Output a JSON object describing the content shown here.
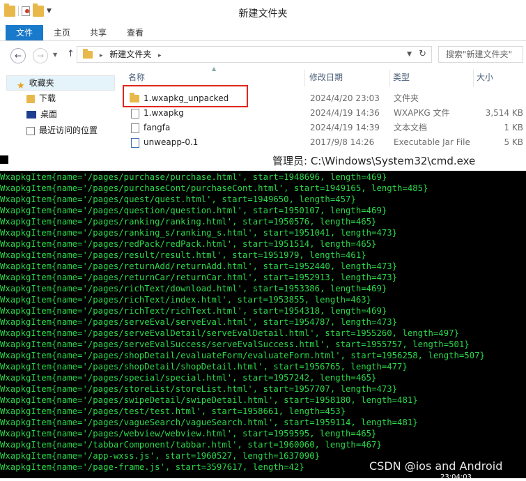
{
  "explorer": {
    "title": "新建文件夹",
    "ribbon_tabs": [
      "文件",
      "主页",
      "共享",
      "查看"
    ],
    "address": {
      "sep": "▸",
      "folder": "新建文件夹"
    },
    "search_placeholder": "搜索\"新建文件夹\"",
    "nav_items": [
      "收藏夹",
      "下载",
      "桌面",
      "最近访问的位置"
    ],
    "columns": [
      "名称",
      "修改日期",
      "类型",
      "大小"
    ],
    "files": [
      {
        "name": "1.wxapkg_unpacked",
        "date": "2024/4/20 23:03",
        "type": "文件夹",
        "size": ""
      },
      {
        "name": "1.wxapkg",
        "date": "2024/4/19 14:36",
        "type": "WXAPKG 文件",
        "size": "3,514 KB"
      },
      {
        "name": "fangfa",
        "date": "2024/4/19 14:39",
        "type": "文本文档",
        "size": "1 KB"
      },
      {
        "name": "unweapp-0.1",
        "date": "2017/9/8 14:26",
        "type": "Executable Jar File",
        "size": "5 KB"
      }
    ]
  },
  "cmd": {
    "title": "管理员: C:\\Windows\\System32\\cmd.exe",
    "lines": [
      "WxapkgItem{name='/pages/purchase/purchase.html', start=1948696, length=469}",
      "WxapkgItem{name='/pages/purchaseCont/purchaseCont.html', start=1949165, length=485}",
      "WxapkgItem{name='/pages/quest/quest.html', start=1949650, length=457}",
      "WxapkgItem{name='/pages/question/question.html', start=1950107, length=469}",
      "WxapkgItem{name='/pages/ranking/ranking.html', start=1950576, length=465}",
      "WxapkgItem{name='/pages/ranking_s/ranking_s.html', start=1951041, length=473}",
      "WxapkgItem{name='/pages/redPack/redPack.html', start=1951514, length=465}",
      "WxapkgItem{name='/pages/result/result.html', start=1951979, length=461}",
      "WxapkgItem{name='/pages/returnAdd/returnAdd.html', start=1952440, length=473}",
      "WxapkgItem{name='/pages/returnCar/returnCar.html', start=1952913, length=473}",
      "WxapkgItem{name='/pages/richText/download.html', start=1953386, length=469}",
      "WxapkgItem{name='/pages/richText/index.html', start=1953855, length=463}",
      "WxapkgItem{name='/pages/richText/richText.html', start=1954318, length=469}",
      "WxapkgItem{name='/pages/serveEval/serveEval.html', start=1954787, length=473}",
      "WxapkgItem{name='/pages/serveEvalDetail/serveEvalDetail.html', start=1955260, length=497}",
      "WxapkgItem{name='/pages/serveEvalSuccess/serveEvalSuccess.html', start=1955757, length=501}",
      "WxapkgItem{name='/pages/shopDetail/evaluateForm/evaluateForm.html', start=1956258, length=507}",
      "WxapkgItem{name='/pages/shopDetail/shopDetail.html', start=1956765, length=477}",
      "WxapkgItem{name='/pages/special/special.html', start=1957242, length=465}",
      "WxapkgItem{name='/pages/storeList/storeList.html', start=1957707, length=473}",
      "WxapkgItem{name='/pages/swipeDetail/swipeDetail.html', start=1958180, length=481}",
      "WxapkgItem{name='/pages/test/test.html', start=1958661, length=453}",
      "WxapkgItem{name='/pages/vagueSearch/vagueSearch.html', start=1959114, length=481}",
      "WxapkgItem{name='/pages/webview/webview.html', start=1959595, length=465}",
      "WxapkgItem{name='/tabbarComponent/tabbar.html', start=1960060, length=467}",
      "WxapkgItem{name='/app-wxss.js', start=1960527, length=1637090}",
      "WxapkgItem{name='/page-frame.js', start=3597617, length=42}"
    ]
  },
  "watermark": "CSDN @ios and Android",
  "taskbar_clock": "23:04:03",
  "colors": {
    "cmd_text": "#2bd84a",
    "file_tab": "#1979ca",
    "highlight": "#e1261c"
  }
}
